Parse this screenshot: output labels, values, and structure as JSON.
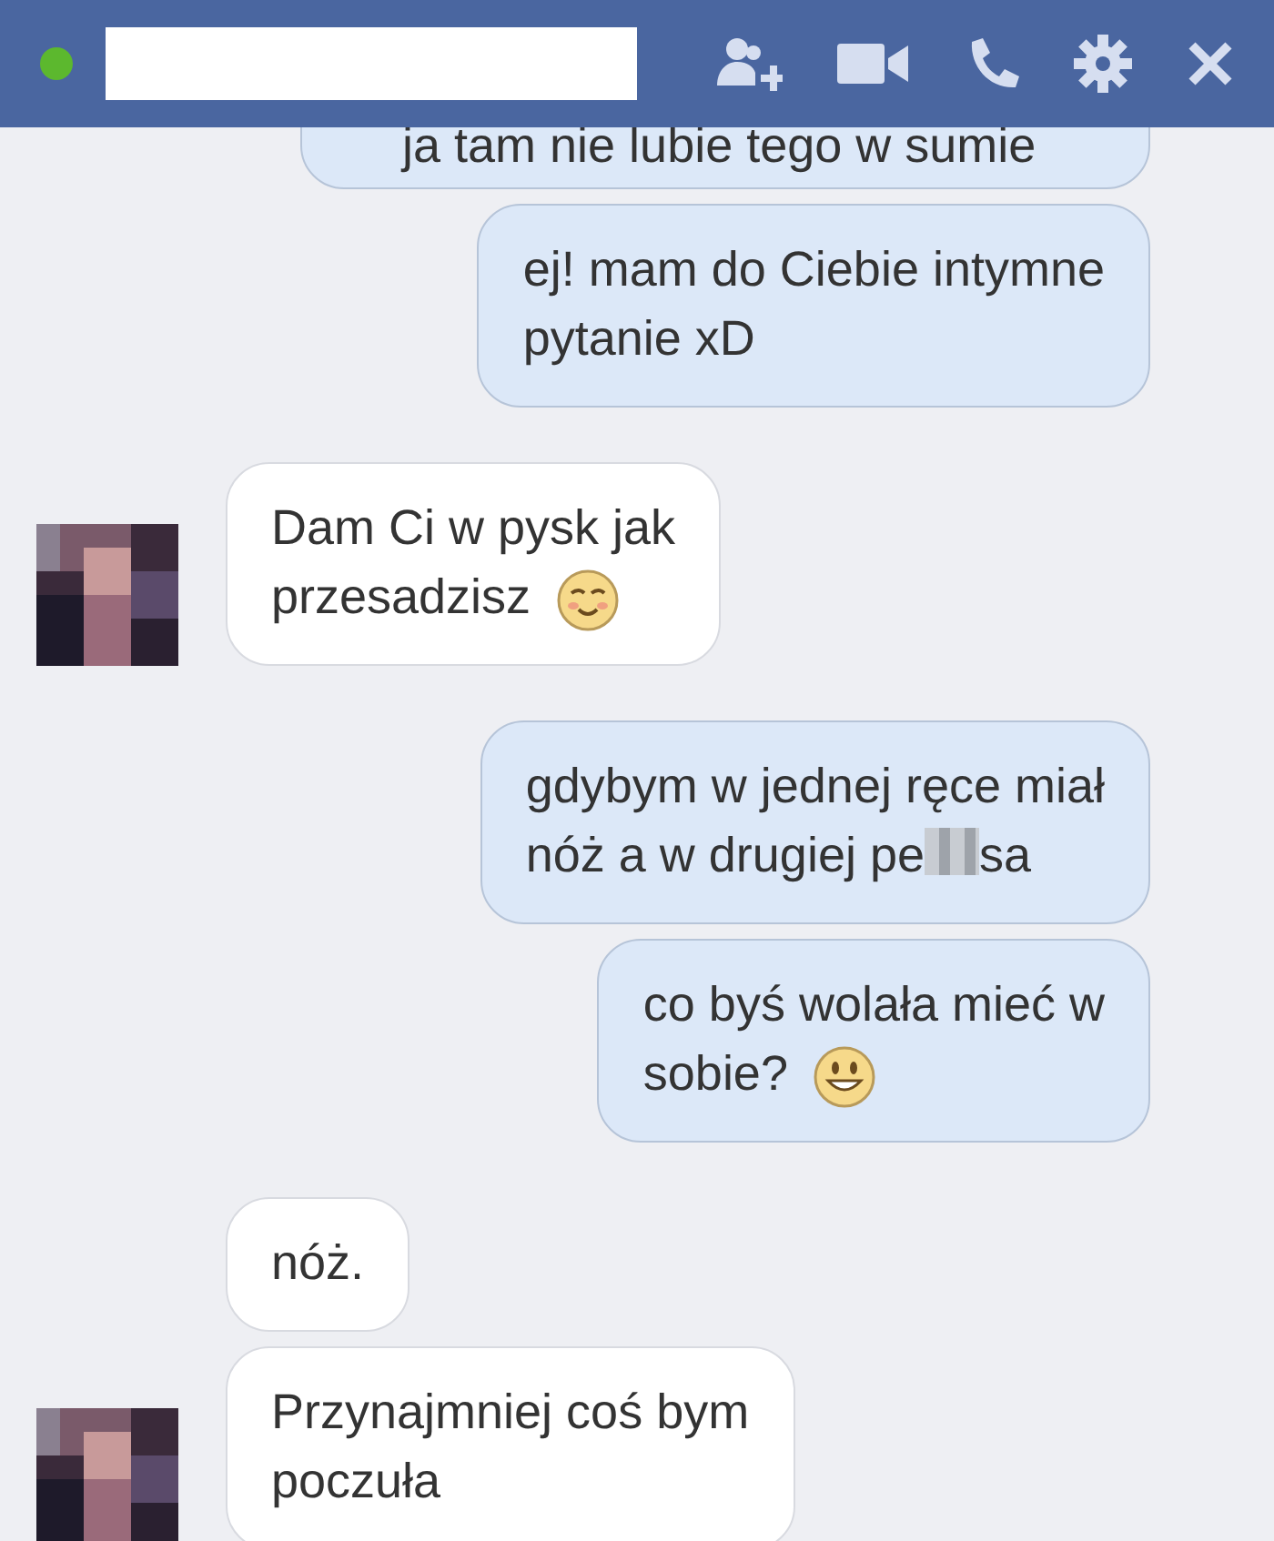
{
  "header": {
    "online": true,
    "icons": [
      {
        "kind": "add-friend"
      },
      {
        "kind": "video"
      },
      {
        "kind": "call"
      },
      {
        "kind": "settings"
      },
      {
        "kind": "close"
      }
    ]
  },
  "groups": [
    {
      "kind": "outgoing",
      "messages": [
        {
          "lines": [
            "ja tam nie lubie tego w sumie"
          ],
          "cut": true
        },
        {
          "lines": [
            "ej! mam do Ciebie intymne",
            "pytanie xD"
          ]
        }
      ]
    },
    {
      "kind": "incoming",
      "avatar": {
        "kind": "picture"
      },
      "messages": [
        {
          "lines": [
            "Dam Ci w pysk jak",
            "przesadzisz"
          ],
          "emoji": {
            "kind": "blush"
          }
        }
      ]
    },
    {
      "kind": "outgoing",
      "messages": [
        {
          "lines": [
            "gdybym w jednej ręce miał",
            "nóż a w drugiej pe"
          ],
          "censored": true,
          "after": "sa"
        },
        {
          "lines": [
            "co byś wolała mieć w",
            "sobie?"
          ],
          "emoji": {
            "kind": "smile"
          }
        }
      ]
    },
    {
      "kind": "incoming",
      "avatar": {
        "kind": "picture"
      },
      "messages": [
        {
          "lines": [
            "nóż."
          ]
        },
        {
          "lines": [
            "Przynajmniej coś bym",
            "poczuła"
          ]
        }
      ]
    }
  ]
}
